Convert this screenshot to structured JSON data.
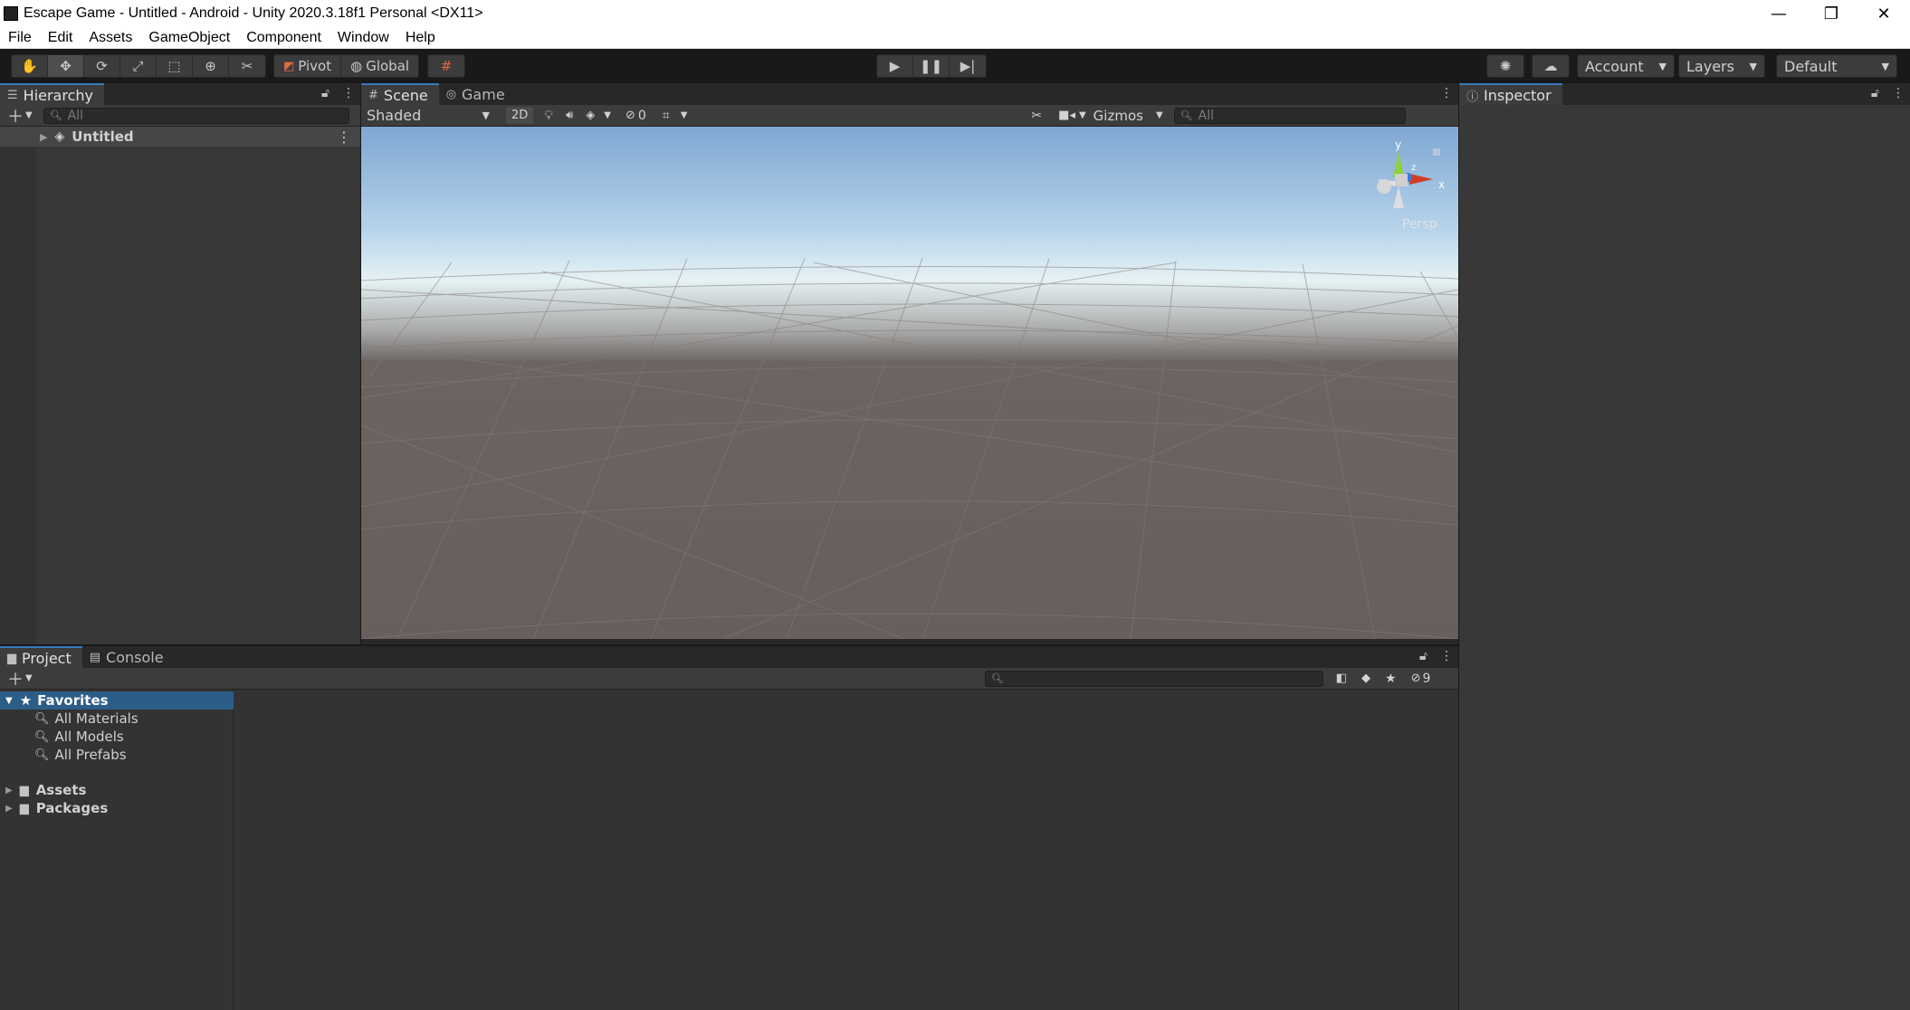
{
  "window": {
    "title": "Escape Game - Untitled - Android - Unity 2020.3.18f1 Personal <DX11>",
    "controls": {
      "minimize": "—",
      "restore": "❐",
      "close": "✕"
    }
  },
  "menu": [
    "File",
    "Edit",
    "Assets",
    "GameObject",
    "Component",
    "Window",
    "Help"
  ],
  "toolbar": {
    "pivot_label": "Pivot",
    "global_label": "Global",
    "account_label": "Account",
    "layers_label": "Layers",
    "layout_label": "Default"
  },
  "hierarchy": {
    "tab": "Hierarchy",
    "search_placeholder": "All",
    "scene_item": "Untitled"
  },
  "scene": {
    "tabs": [
      "Scene",
      "Game"
    ],
    "shading_mode": "Shaded",
    "mode_2d": "2D",
    "hidden_count": "0",
    "gizmos_label": "Gizmos",
    "search_placeholder": "All",
    "axis_y": "y",
    "axis_x": "x",
    "axis_z": "z",
    "projection_label": "Persp"
  },
  "inspector": {
    "tab": "Inspector"
  },
  "project": {
    "tabs": [
      "Project",
      "Console"
    ],
    "hidden_count": "9",
    "favorites_label": "Favorites",
    "favorites": [
      "All Materials",
      "All Models",
      "All Prefabs"
    ],
    "folders": [
      "Assets",
      "Packages"
    ]
  },
  "colors": {
    "accent": "#3a79bb",
    "selection": "#2c5d87",
    "panel": "#383838",
    "toolbar": "#191919"
  }
}
